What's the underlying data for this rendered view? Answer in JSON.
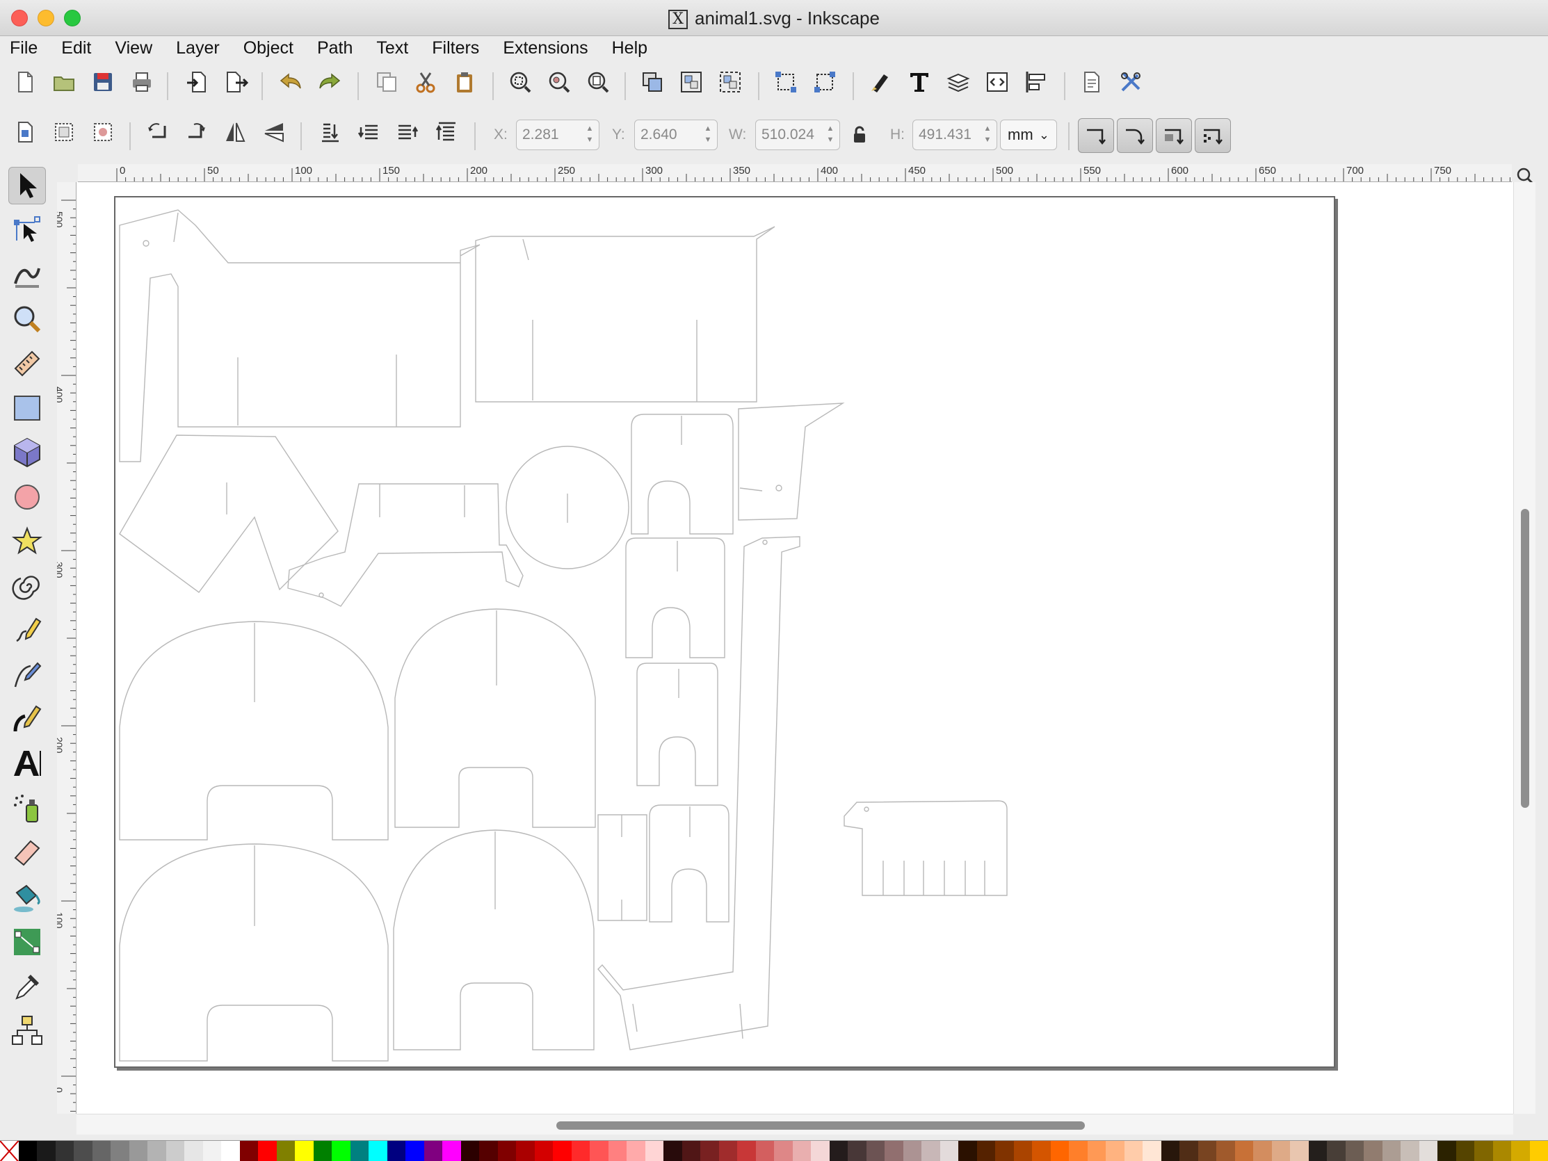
{
  "window": {
    "title": "animal1.svg - Inkscape",
    "x11_glyph": "X",
    "traffic_lights": [
      "#fc5f57",
      "#fdbc2e",
      "#28c840"
    ]
  },
  "menubar": {
    "items": [
      "File",
      "Edit",
      "View",
      "Layer",
      "Object",
      "Path",
      "Text",
      "Filters",
      "Extensions",
      "Help"
    ]
  },
  "commands_toolbar": {
    "icons": [
      "new-document-icon",
      "open-icon",
      "save-icon",
      "print-icon",
      "import-icon",
      "export-icon",
      "undo-icon",
      "redo-icon",
      "duplicate-icon",
      "cut-icon",
      "paste-icon",
      "zoom-selection-icon",
      "zoom-drawing-icon",
      "zoom-page-icon",
      "raise-top-icon",
      "group-icon",
      "ungroup-icon",
      "fill-stroke-icon",
      "text-font-icon",
      "layers-icon",
      "xml-editor-icon",
      "align-icon",
      "document-properties-icon",
      "preferences-icon"
    ]
  },
  "select_toolbar": {
    "x_label": "X:",
    "x_value": "2.281",
    "y_label": "Y:",
    "y_value": "2.640",
    "w_label": "W:",
    "w_value": "510.024",
    "h_label": "H:",
    "h_value": "491.431",
    "unit": "mm"
  },
  "tools": [
    "selector-tool",
    "node-tool",
    "tweak-tool",
    "zoom-tool",
    "measure-tool",
    "rectangle-tool",
    "3d-box-tool",
    "ellipse-tool",
    "star-tool",
    "spiral-tool",
    "pencil-tool",
    "pen-tool",
    "calligraphy-tool",
    "text-tool",
    "spray-tool",
    "eraser-tool",
    "paint-bucket-tool",
    "gradient-tool",
    "dropper-tool",
    "connector-tool"
  ],
  "rulers": {
    "horizontal_labels": [
      "0",
      "50",
      "100",
      "150",
      "200",
      "250",
      "300",
      "350",
      "400",
      "450",
      "500",
      "550",
      "600",
      "650",
      "700",
      "750"
    ],
    "vertical_labels": [
      "500",
      "400",
      "300",
      "200",
      "100",
      "0"
    ]
  },
  "palette": {
    "colors": [
      "#000000",
      "#1a1a1a",
      "#333333",
      "#4d4d4d",
      "#666666",
      "#808080",
      "#999999",
      "#b3b3b3",
      "#cccccc",
      "#e6e6e6",
      "#f2f2f2",
      "#ffffff",
      "#800000",
      "#ff0000",
      "#808000",
      "#ffff00",
      "#008000",
      "#00ff00",
      "#008080",
      "#00ffff",
      "#000080",
      "#0000ff",
      "#800080",
      "#ff00ff",
      "#2b0000",
      "#550000",
      "#800000",
      "#aa0000",
      "#d40000",
      "#ff0000",
      "#ff2a2a",
      "#ff5555",
      "#ff8080",
      "#ffaaaa",
      "#ffd5d5",
      "#280b0b",
      "#501616",
      "#782121",
      "#a02c2c",
      "#c83737",
      "#d35f5f",
      "#de8787",
      "#e9afaf",
      "#f4d7d7",
      "#241c1c",
      "#483737",
      "#6c5353",
      "#916f6f",
      "#ac9393",
      "#c8b7b7",
      "#e3dbdb",
      "#2b1100",
      "#552200",
      "#803300",
      "#aa4400",
      "#d45500",
      "#ff6600",
      "#ff7f2a",
      "#ff9955",
      "#ffb380",
      "#ffccaa",
      "#ffe6d5",
      "#28170b",
      "#502d16",
      "#784421",
      "#a05a2c",
      "#c87137",
      "#d38d5f",
      "#deaa87",
      "#e9c6af",
      "#241f1c",
      "#483e37",
      "#6c5d53",
      "#917c6f",
      "#ac9d93",
      "#c8beb7",
      "#e3dedb",
      "#2b2200",
      "#554400",
      "#806600",
      "#aa8800",
      "#d4aa00",
      "#ffcc00"
    ]
  }
}
